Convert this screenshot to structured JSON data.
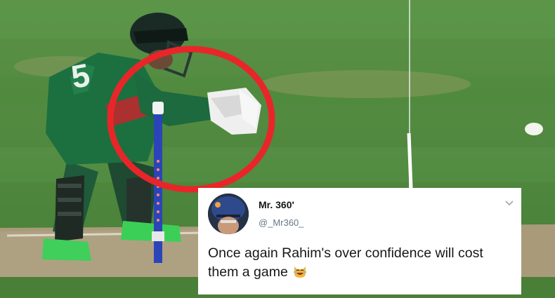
{
  "tweet": {
    "display_name": "Mr. 360'",
    "handle": "@_Mr360_",
    "text": "Once again Rahim's over confidence will cost them a game",
    "emoji_icon": "laughing-cat-emoji"
  },
  "colors": {
    "circle": "#e8262a",
    "grass": "#4f8a3e",
    "jersey": "#1a6b3c"
  }
}
